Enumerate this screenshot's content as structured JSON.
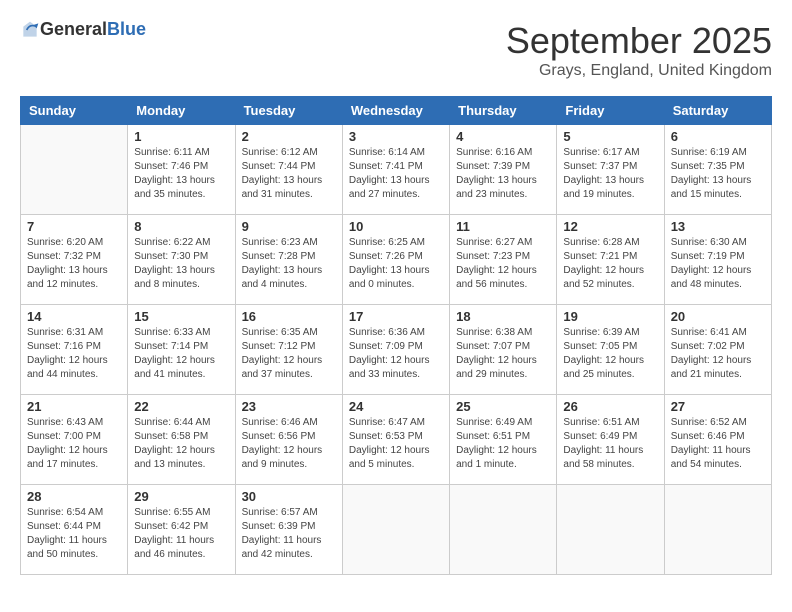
{
  "header": {
    "logo_general": "General",
    "logo_blue": "Blue",
    "month": "September 2025",
    "location": "Grays, England, United Kingdom"
  },
  "weekdays": [
    "Sunday",
    "Monday",
    "Tuesday",
    "Wednesday",
    "Thursday",
    "Friday",
    "Saturday"
  ],
  "weeks": [
    [
      {
        "day": "",
        "info": ""
      },
      {
        "day": "1",
        "info": "Sunrise: 6:11 AM\nSunset: 7:46 PM\nDaylight: 13 hours\nand 35 minutes."
      },
      {
        "day": "2",
        "info": "Sunrise: 6:12 AM\nSunset: 7:44 PM\nDaylight: 13 hours\nand 31 minutes."
      },
      {
        "day": "3",
        "info": "Sunrise: 6:14 AM\nSunset: 7:41 PM\nDaylight: 13 hours\nand 27 minutes."
      },
      {
        "day": "4",
        "info": "Sunrise: 6:16 AM\nSunset: 7:39 PM\nDaylight: 13 hours\nand 23 minutes."
      },
      {
        "day": "5",
        "info": "Sunrise: 6:17 AM\nSunset: 7:37 PM\nDaylight: 13 hours\nand 19 minutes."
      },
      {
        "day": "6",
        "info": "Sunrise: 6:19 AM\nSunset: 7:35 PM\nDaylight: 13 hours\nand 15 minutes."
      }
    ],
    [
      {
        "day": "7",
        "info": "Sunrise: 6:20 AM\nSunset: 7:32 PM\nDaylight: 13 hours\nand 12 minutes."
      },
      {
        "day": "8",
        "info": "Sunrise: 6:22 AM\nSunset: 7:30 PM\nDaylight: 13 hours\nand 8 minutes."
      },
      {
        "day": "9",
        "info": "Sunrise: 6:23 AM\nSunset: 7:28 PM\nDaylight: 13 hours\nand 4 minutes."
      },
      {
        "day": "10",
        "info": "Sunrise: 6:25 AM\nSunset: 7:26 PM\nDaylight: 13 hours\nand 0 minutes."
      },
      {
        "day": "11",
        "info": "Sunrise: 6:27 AM\nSunset: 7:23 PM\nDaylight: 12 hours\nand 56 minutes."
      },
      {
        "day": "12",
        "info": "Sunrise: 6:28 AM\nSunset: 7:21 PM\nDaylight: 12 hours\nand 52 minutes."
      },
      {
        "day": "13",
        "info": "Sunrise: 6:30 AM\nSunset: 7:19 PM\nDaylight: 12 hours\nand 48 minutes."
      }
    ],
    [
      {
        "day": "14",
        "info": "Sunrise: 6:31 AM\nSunset: 7:16 PM\nDaylight: 12 hours\nand 44 minutes."
      },
      {
        "day": "15",
        "info": "Sunrise: 6:33 AM\nSunset: 7:14 PM\nDaylight: 12 hours\nand 41 minutes."
      },
      {
        "day": "16",
        "info": "Sunrise: 6:35 AM\nSunset: 7:12 PM\nDaylight: 12 hours\nand 37 minutes."
      },
      {
        "day": "17",
        "info": "Sunrise: 6:36 AM\nSunset: 7:09 PM\nDaylight: 12 hours\nand 33 minutes."
      },
      {
        "day": "18",
        "info": "Sunrise: 6:38 AM\nSunset: 7:07 PM\nDaylight: 12 hours\nand 29 minutes."
      },
      {
        "day": "19",
        "info": "Sunrise: 6:39 AM\nSunset: 7:05 PM\nDaylight: 12 hours\nand 25 minutes."
      },
      {
        "day": "20",
        "info": "Sunrise: 6:41 AM\nSunset: 7:02 PM\nDaylight: 12 hours\nand 21 minutes."
      }
    ],
    [
      {
        "day": "21",
        "info": "Sunrise: 6:43 AM\nSunset: 7:00 PM\nDaylight: 12 hours\nand 17 minutes."
      },
      {
        "day": "22",
        "info": "Sunrise: 6:44 AM\nSunset: 6:58 PM\nDaylight: 12 hours\nand 13 minutes."
      },
      {
        "day": "23",
        "info": "Sunrise: 6:46 AM\nSunset: 6:56 PM\nDaylight: 12 hours\nand 9 minutes."
      },
      {
        "day": "24",
        "info": "Sunrise: 6:47 AM\nSunset: 6:53 PM\nDaylight: 12 hours\nand 5 minutes."
      },
      {
        "day": "25",
        "info": "Sunrise: 6:49 AM\nSunset: 6:51 PM\nDaylight: 12 hours\nand 1 minute."
      },
      {
        "day": "26",
        "info": "Sunrise: 6:51 AM\nSunset: 6:49 PM\nDaylight: 11 hours\nand 58 minutes."
      },
      {
        "day": "27",
        "info": "Sunrise: 6:52 AM\nSunset: 6:46 PM\nDaylight: 11 hours\nand 54 minutes."
      }
    ],
    [
      {
        "day": "28",
        "info": "Sunrise: 6:54 AM\nSunset: 6:44 PM\nDaylight: 11 hours\nand 50 minutes."
      },
      {
        "day": "29",
        "info": "Sunrise: 6:55 AM\nSunset: 6:42 PM\nDaylight: 11 hours\nand 46 minutes."
      },
      {
        "day": "30",
        "info": "Sunrise: 6:57 AM\nSunset: 6:39 PM\nDaylight: 11 hours\nand 42 minutes."
      },
      {
        "day": "",
        "info": ""
      },
      {
        "day": "",
        "info": ""
      },
      {
        "day": "",
        "info": ""
      },
      {
        "day": "",
        "info": ""
      }
    ]
  ]
}
